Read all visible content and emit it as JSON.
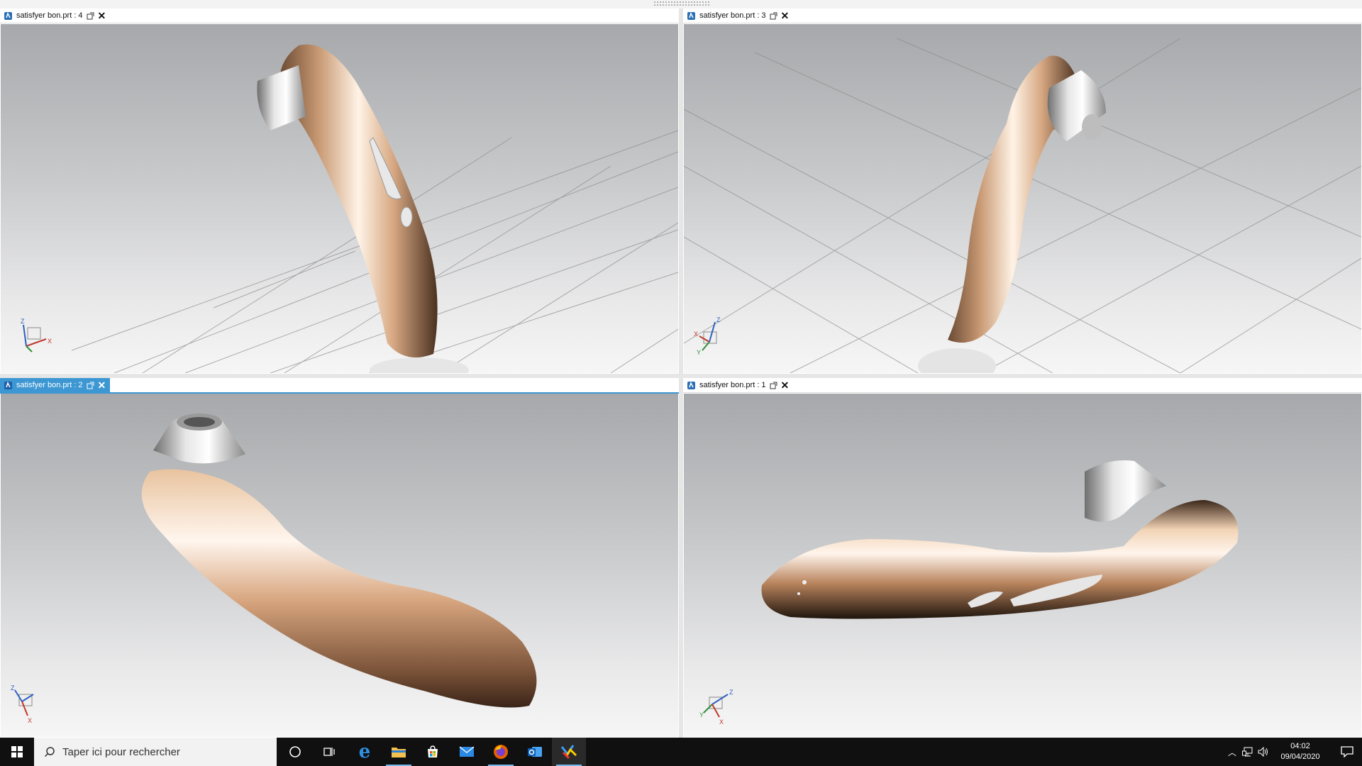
{
  "viewports": [
    {
      "tab_label": "satisfyer bon.prt : 4",
      "active": false
    },
    {
      "tab_label": "satisfyer bon.prt : 3",
      "active": false
    },
    {
      "tab_label": "satisfyer bon.prt : 2",
      "active": true
    },
    {
      "tab_label": "satisfyer bon.prt : 1",
      "active": false
    }
  ],
  "axis_labels": {
    "x": "X",
    "y": "Y",
    "z": "Z"
  },
  "colors": {
    "accent": "#3c97d3",
    "model_body": "#d9aa84",
    "model_cap": "#d8d8d8",
    "taskbar": "#101010"
  },
  "taskbar": {
    "search_placeholder": "Taper ici pour rechercher",
    "apps": [
      "cortana-icon",
      "task-view-icon",
      "edge-icon",
      "file-explorer-icon",
      "store-icon",
      "mail-icon",
      "firefox-icon",
      "outlook-icon",
      "cad-app-icon"
    ],
    "clock": {
      "time": "04:02",
      "date": "09/04/2020"
    }
  }
}
